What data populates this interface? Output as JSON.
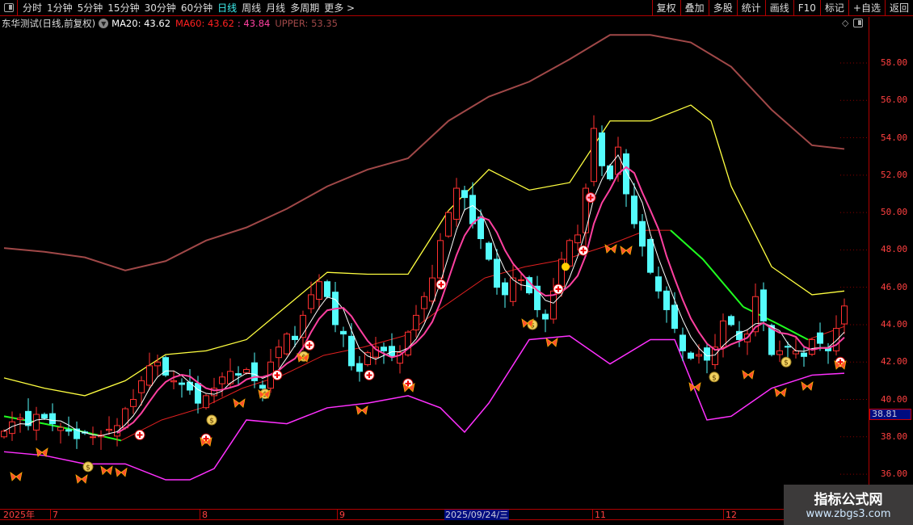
{
  "toolbar": {
    "periods": [
      "分时",
      "1分钟",
      "5分钟",
      "15分钟",
      "30分钟",
      "60分钟",
      "日线",
      "周线",
      "月线",
      "多周期",
      "更多 >"
    ],
    "active": "日线",
    "buttons": [
      "复权",
      "叠加",
      "多股",
      "统计",
      "画线",
      "F10",
      "标记",
      "+自选",
      "返回"
    ]
  },
  "legend": {
    "title": "东华测试(日线,前复权)",
    "ma20": "MA20: 43.62",
    "ma60": "MA60: 43.62",
    "ma60b": ": 43.84",
    "upper": "UPPER: 53.35"
  },
  "colors": {
    "up": "#ff3030",
    "down": "#54fcfc",
    "ma_white": "#ffffff",
    "ma_pink": "#ff40a0",
    "ma60_up": "#e02020",
    "ma60_down": "#20ff20",
    "upper": "#a04848",
    "mid": "#ffff40",
    "lower": "#ff30ff"
  },
  "yaxis": {
    "ticks": [
      "58.00",
      "56.00",
      "54.00",
      "52.00",
      "50.00",
      "48.00",
      "46.00",
      "44.00",
      "42.00",
      "40.00",
      "38.00",
      "36.00"
    ],
    "current_price": "38.81"
  },
  "xaxis": {
    "labels": [
      {
        "text": "2025年",
        "idx": 0
      },
      {
        "text": "7",
        "idx": 5.7
      },
      {
        "text": "8",
        "idx": 24.2
      },
      {
        "text": "9",
        "idx": 41.2
      },
      {
        "text": "11",
        "idx": 72.8
      },
      {
        "text": "12",
        "idx": 89
      }
    ],
    "highlight": "2025/09/24/三"
  },
  "watermark": {
    "line1": "指标公式网",
    "line2": "www.zbgs3.com"
  },
  "chart_data": {
    "type": "candlestick",
    "ylim": [
      35.5,
      59.7
    ],
    "close": [
      38.3,
      38.8,
      39,
      38.6,
      39.2,
      39,
      38.7,
      38.5,
      38.3,
      37.9,
      38.2,
      38,
      38.1,
      38.4,
      38.6,
      39.5,
      40,
      41,
      41.8,
      42,
      41.3,
      41,
      40.8,
      40.5,
      39.8,
      40.2,
      40.6,
      41.2,
      41.5,
      41.3,
      41.6,
      41,
      40.6,
      42,
      42.8,
      43.5,
      43.2,
      44.5,
      45.6,
      46.3,
      45.5,
      44,
      43.5,
      41.8,
      41.5,
      42.5,
      42.8,
      42.6,
      42.3,
      42.5,
      43.6,
      44.5,
      45.5,
      46.5,
      48.5,
      50,
      51.3,
      50.8,
      49.4,
      48.6,
      47.5,
      46,
      45.6,
      46.5,
      46.4,
      45.7,
      44.8,
      44.3,
      45.8,
      47.5,
      48.5,
      48.8,
      51.3,
      54.5,
      52.5,
      51.8,
      53.5,
      51,
      49.4,
      48.2,
      46.8,
      45.8,
      44.8,
      43.8,
      42.6,
      42.2,
      42.4,
      42.1,
      42.8,
      44.2,
      44,
      43.2,
      43.5,
      45.5,
      44.2,
      42.4,
      42.6,
      42.8,
      42.6,
      42.3,
      43.2,
      43,
      42.6,
      43.8,
      45
    ],
    "upper": [
      [
        0,
        48.1
      ],
      [
        5,
        47.9
      ],
      [
        10,
        47.6
      ],
      [
        15,
        46.9
      ],
      [
        20,
        47.4
      ],
      [
        25,
        48.5
      ],
      [
        30,
        49.2
      ],
      [
        35,
        50.2
      ],
      [
        40,
        51.4
      ],
      [
        45,
        52.3
      ],
      [
        50,
        52.9
      ],
      [
        55,
        54.9
      ],
      [
        60,
        56.2
      ],
      [
        65,
        57
      ],
      [
        70,
        58.2
      ],
      [
        75,
        59.5
      ],
      [
        80,
        59.5
      ],
      [
        85,
        59.1
      ],
      [
        90,
        57.8
      ],
      [
        95,
        55.5
      ],
      [
        100,
        53.6
      ],
      [
        104,
        53.4
      ]
    ],
    "mid": [
      [
        0,
        41.15
      ],
      [
        5,
        40.6
      ],
      [
        10,
        40.2
      ],
      [
        15,
        41
      ],
      [
        20,
        42.4
      ],
      [
        25,
        42.6
      ],
      [
        30,
        43.2
      ],
      [
        35,
        45
      ],
      [
        40,
        46.8
      ],
      [
        45,
        46.7
      ],
      [
        50,
        46.7
      ],
      [
        55,
        50.1
      ],
      [
        60,
        52.3
      ],
      [
        65,
        51.2
      ],
      [
        70,
        51.6
      ],
      [
        75,
        54.9
      ],
      [
        80,
        54.9
      ],
      [
        85,
        55.75
      ],
      [
        87.5,
        54.9
      ],
      [
        90,
        51.4
      ],
      [
        95,
        47.1
      ],
      [
        100,
        45.6
      ],
      [
        104,
        45.8
      ]
    ],
    "ma60": [
      [
        0,
        39.1
      ],
      [
        5,
        38.7
      ],
      [
        10,
        38.25
      ],
      [
        14.5,
        37.8
      ],
      [
        19.5,
        38.9
      ],
      [
        24.5,
        39.55
      ],
      [
        29.5,
        40.6
      ],
      [
        34.5,
        41.3
      ],
      [
        39.5,
        42.35
      ],
      [
        44.5,
        42.8
      ],
      [
        49.5,
        43.4
      ],
      [
        54.5,
        45
      ],
      [
        59.5,
        46.5
      ],
      [
        64.5,
        47.1
      ],
      [
        69.5,
        47.5
      ],
      [
        74.5,
        48.2
      ],
      [
        79.5,
        49.05
      ],
      [
        82.5,
        49.05
      ],
      [
        86.5,
        47.5
      ],
      [
        91.5,
        44.95
      ],
      [
        95.5,
        44.1
      ],
      [
        99.5,
        43.2
      ],
      [
        104,
        43.9
      ]
    ],
    "lower": [
      [
        0,
        37.2
      ],
      [
        5,
        37
      ],
      [
        10,
        36.55
      ],
      [
        15,
        36.55
      ],
      [
        20,
        35.7
      ],
      [
        23,
        35.7
      ],
      [
        26,
        36.3
      ],
      [
        30,
        38.9
      ],
      [
        35,
        38.7
      ],
      [
        40,
        39.55
      ],
      [
        45,
        39.8
      ],
      [
        50,
        40.2
      ],
      [
        54,
        39.55
      ],
      [
        57,
        38.25
      ],
      [
        60,
        39.8
      ],
      [
        65,
        43.2
      ],
      [
        70,
        43.4
      ],
      [
        75,
        41.9
      ],
      [
        80,
        43.2
      ],
      [
        83,
        43.2
      ],
      [
        87,
        38.9
      ],
      [
        90,
        39.1
      ],
      [
        95,
        40.6
      ],
      [
        100,
        41.3
      ],
      [
        104,
        41.4
      ]
    ],
    "markers": [
      {
        "t": "plus",
        "i": 16.8,
        "p": 38.1
      },
      {
        "t": "plus",
        "i": 25,
        "p": 37.9
      },
      {
        "t": "plus",
        "i": 33.8,
        "p": 41.3
      },
      {
        "t": "plus",
        "i": 37.8,
        "p": 42.9
      },
      {
        "t": "plus",
        "i": 45.2,
        "p": 41.3
      },
      {
        "t": "plus",
        "i": 50,
        "p": 40.85
      },
      {
        "t": "plus",
        "i": 54.1,
        "p": 46.15
      },
      {
        "t": "plus",
        "i": 68.6,
        "p": 45.9
      },
      {
        "t": "plus",
        "i": 71.7,
        "p": 47.97
      },
      {
        "t": "plus",
        "i": 103.5,
        "p": 42.0
      },
      {
        "t": "pinkplus",
        "i": 72.6,
        "p": 50.8
      },
      {
        "t": "money",
        "i": 10.4,
        "p": 36.4
      },
      {
        "t": "money",
        "i": 25.7,
        "p": 38.9
      },
      {
        "t": "money",
        "i": 32.3,
        "p": 40.3
      },
      {
        "t": "money",
        "i": 37.1,
        "p": 42.3
      },
      {
        "t": "money",
        "i": 65.4,
        "p": 44.0
      },
      {
        "t": "money",
        "i": 87.9,
        "p": 41.2
      },
      {
        "t": "money",
        "i": 96.8,
        "p": 42.0
      },
      {
        "t": "fly",
        "i": 1.5,
        "p": 35.87
      },
      {
        "t": "fly",
        "i": 4.7,
        "p": 37.17
      },
      {
        "t": "fly",
        "i": 9.6,
        "p": 35.74
      },
      {
        "t": "fly",
        "i": 12.7,
        "p": 36.2
      },
      {
        "t": "fly",
        "i": 14.5,
        "p": 36.1
      },
      {
        "t": "fly",
        "i": 25,
        "p": 37.73
      },
      {
        "t": "fly",
        "i": 29.1,
        "p": 39.8
      },
      {
        "t": "fly",
        "i": 32.2,
        "p": 40.28
      },
      {
        "t": "fly",
        "i": 37,
        "p": 42.23
      },
      {
        "t": "fly",
        "i": 44.3,
        "p": 39.42
      },
      {
        "t": "fly",
        "i": 50.1,
        "p": 40.63
      },
      {
        "t": "fly",
        "i": 64.8,
        "p": 44.08
      },
      {
        "t": "fly",
        "i": 67.8,
        "p": 43.05
      },
      {
        "t": "fly",
        "i": 75.1,
        "p": 48.06
      },
      {
        "t": "fly",
        "i": 77,
        "p": 47.97
      },
      {
        "t": "fly",
        "i": 85.5,
        "p": 40.67
      },
      {
        "t": "fly",
        "i": 92.1,
        "p": 41.32
      },
      {
        "t": "fly",
        "i": 96.1,
        "p": 40.37
      },
      {
        "t": "fly",
        "i": 99.4,
        "p": 40.71
      },
      {
        "t": "fly",
        "i": 103.5,
        "p": 41.84
      },
      {
        "t": "dot",
        "i": 69.5,
        "p": 47.1
      }
    ]
  }
}
